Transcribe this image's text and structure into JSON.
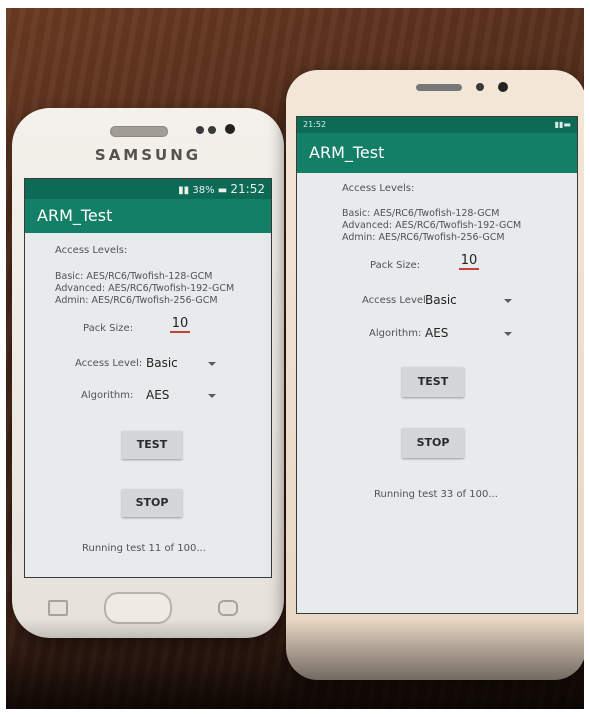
{
  "phone_left": {
    "brand": "SAMSUNG",
    "status_bar": {
      "battery": "38%",
      "time": "21:52"
    },
    "app_title": "ARM_Test",
    "access_levels_heading": "Access Levels:",
    "access_levels": [
      "Basic: AES/RC6/Twofish-128-GCM",
      "Advanced: AES/RC6/Twofish-192-GCM",
      "Admin: AES/RC6/Twofish-256-GCM"
    ],
    "pack_size_label": "Pack Size:",
    "pack_size_value": "10",
    "access_level_label": "Access Level:",
    "access_level_value": "Basic",
    "algorithm_label": "Algorithm:",
    "algorithm_value": "AES",
    "test_button": "TEST",
    "stop_button": "STOP",
    "status_text": "Running test 11 of 100..."
  },
  "phone_right": {
    "status_bar": {
      "time": "21:52"
    },
    "app_title": "ARM_Test",
    "access_levels_heading": "Access Levels:",
    "access_levels": [
      "Basic: AES/RC6/Twofish-128-GCM",
      "Advanced: AES/RC6/Twofish-192-GCM",
      "Admin: AES/RC6/Twofish-256-GCM"
    ],
    "pack_size_label": "Pack Size:",
    "pack_size_value": "10",
    "access_level_label": "Access Level",
    "access_level_value": "Basic",
    "algorithm_label": "Algorithm:",
    "algorithm_value": "AES",
    "test_button": "TEST",
    "stop_button": "STOP",
    "status_text": "Running test 33 of 100..."
  },
  "colors": {
    "app_bar": "#137f66",
    "status_bar": "#0c6a55",
    "screen_bg": "#e8ebec",
    "underline": "#c4413b",
    "table_wood": "#512c1b"
  }
}
